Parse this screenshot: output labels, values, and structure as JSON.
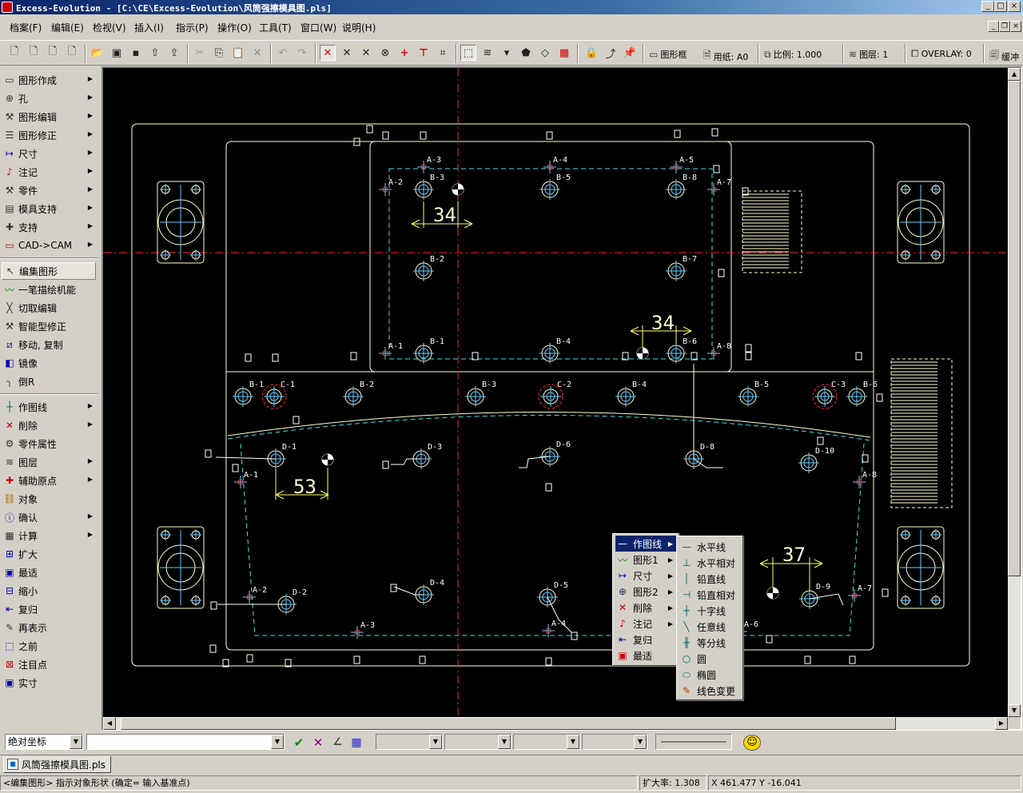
{
  "window": {
    "title": "Excess-Evolution - [C:\\CE\\Excess-Evolution\\风筒强擦模具图.pls]"
  },
  "menubar": {
    "items": [
      "档案(F)",
      "编辑(E)",
      "检视(V)",
      "插入(I)",
      "指示(P)",
      "操作(O)",
      "工具(T)",
      "窗口(W)",
      "说明(H)"
    ]
  },
  "toolbar": {
    "frame_label": "图形框",
    "paper_label": "用纸: A0",
    "scale_label": "比例: 1.000",
    "layer_label": "图层: 1",
    "overlay_label": "OVERLAY: 0",
    "buffer_label": "缓冲"
  },
  "left_panel": {
    "group1": [
      "图形作成",
      "孔",
      "图形编辑",
      "图形修正",
      "尺寸",
      "注记",
      "零件",
      "模具支持",
      "支持",
      "CAD->CAM"
    ],
    "group2": [
      "编集图形",
      "一笔描绘机能",
      "切取编辑",
      "智能型修正",
      "移动, 复制",
      "镜像",
      "倒R"
    ],
    "group3": [
      "作图线",
      "削除",
      "零件属性",
      "图层",
      "辅助原点",
      "对象",
      "确认",
      "计算",
      "扩大",
      "最适",
      "缩小",
      "复归",
      "再表示",
      "之前",
      "注目点",
      "实寸"
    ]
  },
  "drawing": {
    "dims": [
      "34",
      "34",
      "53",
      "37"
    ],
    "labels": {
      "a_top": [
        "A-3",
        "A-4",
        "A-5",
        "A-2",
        "A-7",
        "A-1",
        "A-8"
      ],
      "b_top": [
        "B-3",
        "B-5",
        "B-8",
        "B-2",
        "B-7",
        "B-1",
        "B-4",
        "B-6"
      ],
      "b_row": [
        "B-1",
        "B-2",
        "B-3",
        "B-4",
        "B-5",
        "B-6"
      ],
      "c_row": [
        "C-1",
        "C-2",
        "C-3"
      ],
      "d_row": [
        "D-1",
        "D-3",
        "D-6",
        "D-8",
        "D-10",
        "D-2",
        "D-4",
        "D-5",
        "D-9"
      ],
      "a_bottom": [
        "A-1",
        "A-8",
        "A-2",
        "A-3",
        "A-4",
        "A-6",
        "A-7"
      ]
    }
  },
  "context_menu": {
    "items": [
      {
        "label": "作图线",
        "icon": "line-icon",
        "submenu": true,
        "highlighted": true
      },
      {
        "label": "图形1",
        "icon": "polyline-icon",
        "submenu": true
      },
      {
        "label": "尺寸",
        "icon": "dimension-icon",
        "submenu": true
      },
      {
        "label": "图形2",
        "icon": "circle-cross-icon",
        "submenu": true
      },
      {
        "label": "削除",
        "icon": "delete-icon",
        "submenu": true
      },
      {
        "label": "注记",
        "icon": "note-icon",
        "submenu": true
      },
      {
        "label": "复归",
        "icon": "restore-icon",
        "submenu": false
      },
      {
        "label": "最适",
        "icon": "fit-icon",
        "submenu": false
      }
    ]
  },
  "submenu": {
    "items": [
      "水平线",
      "水平相对",
      "铅直线",
      "铅直相对",
      "十字线",
      "任意线",
      "等分线",
      "圆",
      "椭圆",
      "线色变更"
    ]
  },
  "inputbar": {
    "coord_mode": "绝对坐标",
    "command_value": ""
  },
  "doc_tab": {
    "label": "风筒强擦模具图.pls"
  },
  "status": {
    "prompt": "<编集图形> 指示对象形状 (确定= 输入基准点)",
    "zoom": "扩大率: 1.308",
    "coords": "X 461.477 Y -16.041"
  },
  "colors": {
    "canvas_bg": "#000000",
    "outline": "#ffffcc",
    "hole": "#66ccff",
    "center_line": "#ff2020",
    "dashed": "#40e0e0",
    "menu_highlight": "#0a246a"
  }
}
